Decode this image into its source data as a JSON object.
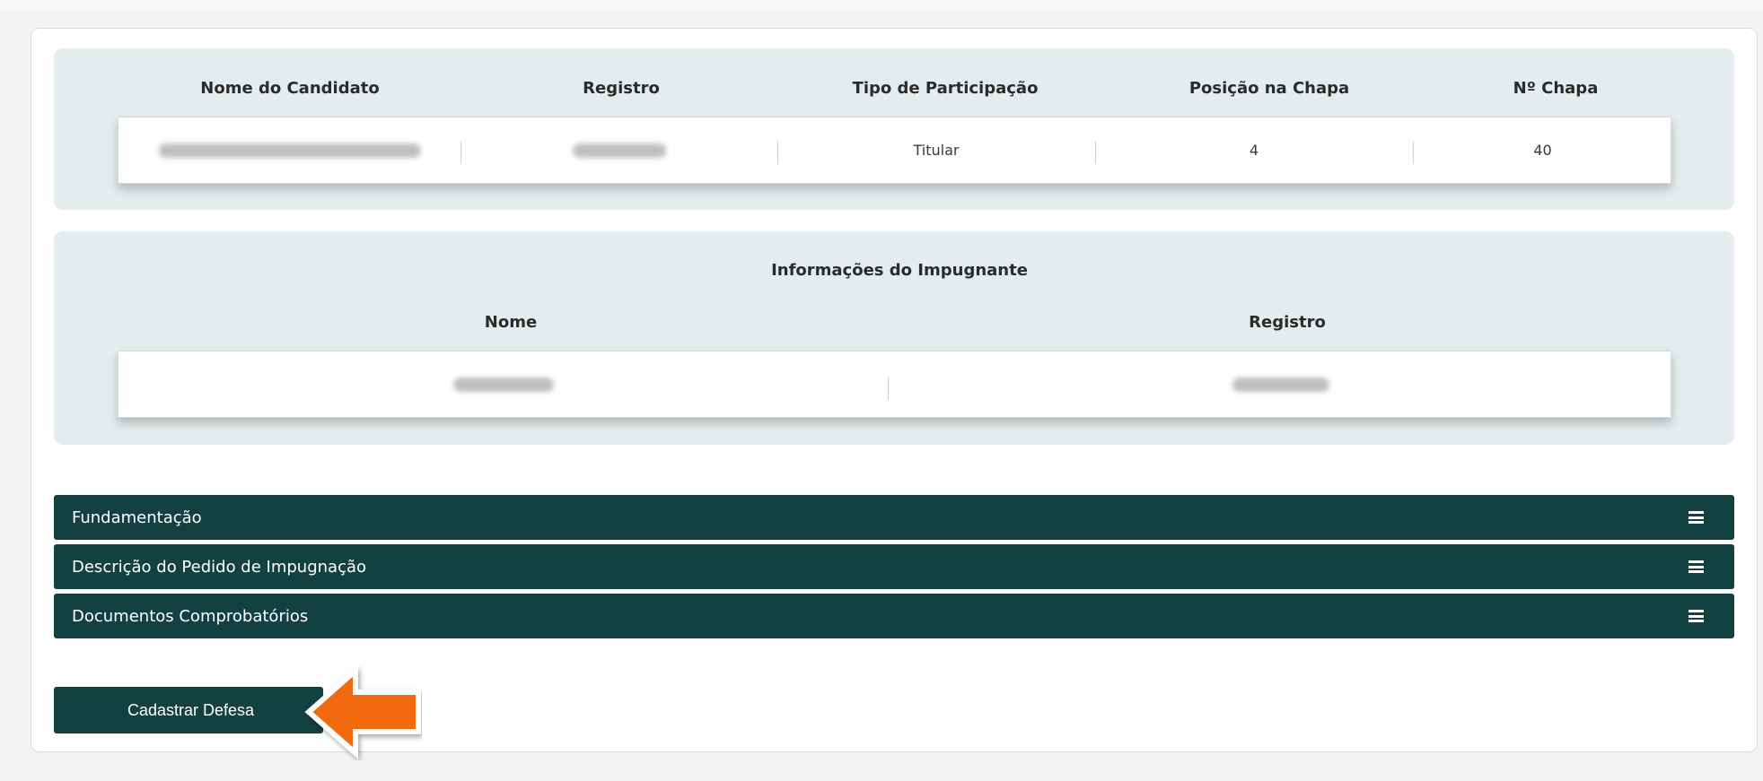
{
  "candidate_table": {
    "headers": {
      "nome": "Nome do Candidato",
      "registro": "Registro",
      "tipo": "Tipo de Participação",
      "posicao": "Posição na Chapa",
      "chapa": "Nº Chapa"
    },
    "row": {
      "tipo": "Titular",
      "posicao": "4",
      "chapa": "40"
    }
  },
  "impugnante": {
    "title": "Informações do Impugnante",
    "headers": {
      "nome": "Nome",
      "registro": "Registro"
    }
  },
  "accordions": [
    {
      "label": "Fundamentação",
      "icon": "menu-icon"
    },
    {
      "label": "Descrição do Pedido de Impugnação",
      "icon": "menu-icon"
    },
    {
      "label": "Documentos Comprobatórios",
      "icon": "menu-icon"
    }
  ],
  "actions": {
    "cadastrar_defesa": "Cadastrar Defesa"
  },
  "colors": {
    "panel_bg": "#e3eded",
    "accent_dark": "#134141",
    "arrow": "#f26a0f"
  }
}
